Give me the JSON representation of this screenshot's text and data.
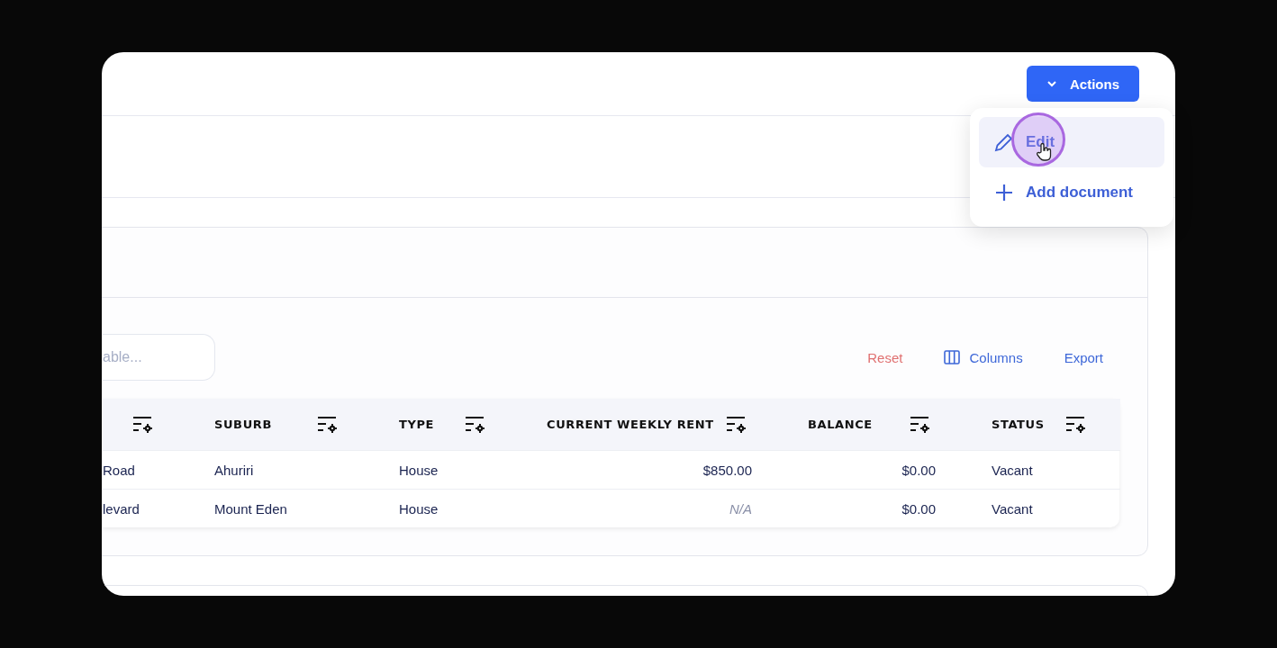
{
  "header": {
    "actions_button": {
      "label": "Actions",
      "expanded": true
    }
  },
  "actions_menu": {
    "items": [
      {
        "kind": "edit",
        "label": "Edit",
        "selected": true
      },
      {
        "kind": "add",
        "label": "Add document",
        "selected": false
      }
    ]
  },
  "table_panel": {
    "search": {
      "placeholder": "able..."
    },
    "toolbar": [
      {
        "kind": "reset",
        "label": "Reset"
      },
      {
        "kind": "columns",
        "label": "Columns"
      },
      {
        "kind": "export",
        "label": "Export"
      }
    ],
    "table": {
      "columns": [
        {
          "kind": "text"
        },
        {
          "kind": "text",
          "label": "SUBURB"
        },
        {
          "kind": "text",
          "label": "TYPE"
        },
        {
          "kind": "amount",
          "label": "CURRENT WEEKLY RENT"
        },
        {
          "kind": "amount",
          "label": "BALANCE"
        },
        {
          "kind": "text",
          "label": "STATUS"
        }
      ],
      "rows": [
        {
          "cells": [
            {
              "text": "Road",
              "muted": false
            },
            {
              "text": "Ahuriri",
              "muted": false
            },
            {
              "text": "House",
              "muted": false
            },
            {
              "text": "$850.00",
              "muted": false
            },
            {
              "text": "$0.00",
              "muted": false
            },
            {
              "text": "Vacant",
              "muted": false
            }
          ]
        },
        {
          "cells": [
            {
              "text": "levard",
              "muted": false
            },
            {
              "text": "Mount Eden",
              "muted": false
            },
            {
              "text": "House",
              "muted": false
            },
            {
              "text": "N/A",
              "muted": true
            },
            {
              "text": "$0.00",
              "muted": false
            },
            {
              "text": "Vacant",
              "muted": false
            }
          ]
        }
      ]
    }
  }
}
